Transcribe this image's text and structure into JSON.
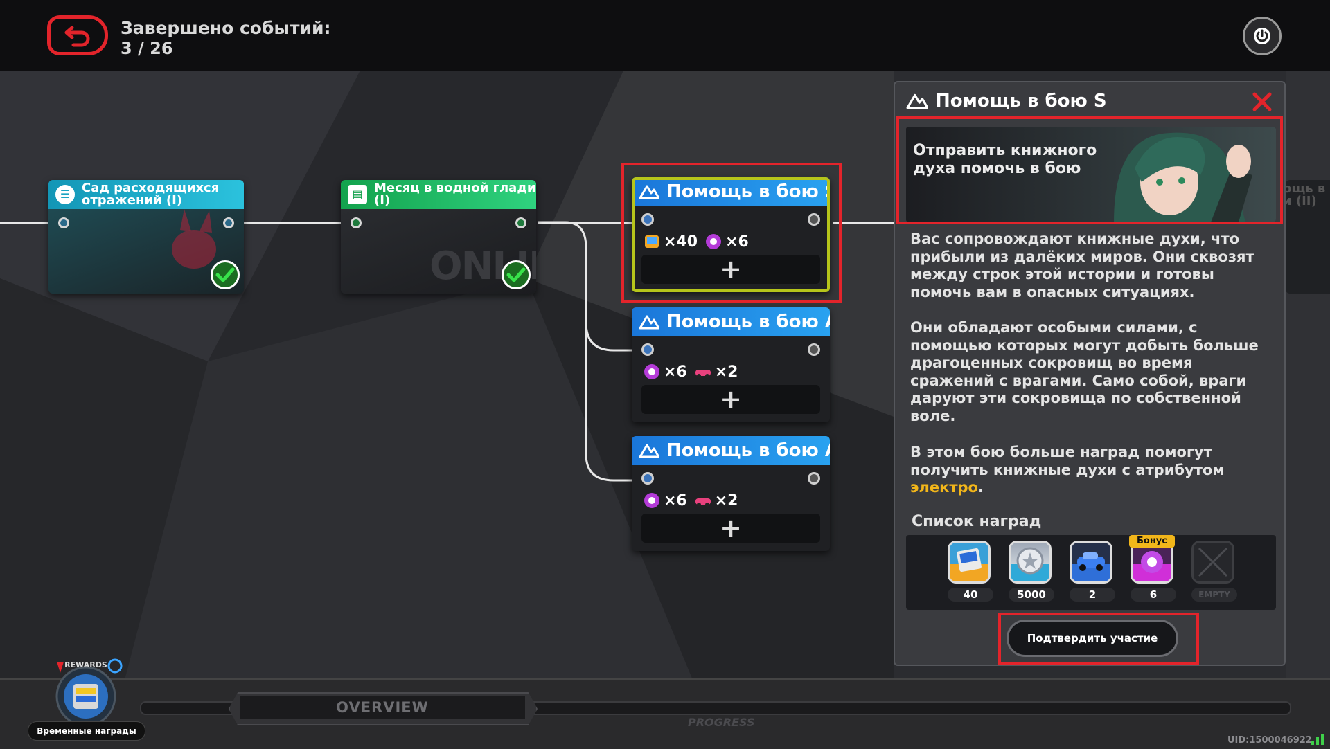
{
  "header": {
    "events_completed_label": "Завершено событий:",
    "events_completed_count": "3 / 26"
  },
  "nodes": [
    {
      "title": "Сад расходящихся отражений (I)",
      "completed": true,
      "color": "#1aa3c2"
    },
    {
      "title": "Месяц в водной глади (I)",
      "completed": true,
      "color": "#1fb867",
      "art_text": "ONLINE"
    }
  ],
  "battle_nodes": [
    {
      "title": "Помощь в бою S",
      "rewards": [
        {
          "icon": "book-card-icon",
          "qty": "×40"
        },
        {
          "icon": "purple-gear-icon",
          "qty": "×6"
        }
      ],
      "add_label": "+"
    },
    {
      "title": "Помощь в бою A",
      "rewards": [
        {
          "icon": "purple-gear-icon",
          "qty": "×6"
        },
        {
          "icon": "car-icon",
          "qty": "×2"
        }
      ],
      "add_label": "+"
    },
    {
      "title": "Помощь в бою A",
      "rewards": [
        {
          "icon": "purple-gear-icon",
          "qty": "×6"
        },
        {
          "icon": "car-icon",
          "qty": "×2"
        }
      ],
      "add_label": "+"
    }
  ],
  "panel": {
    "title": "Помощь в бою S",
    "banner_text": "Отправить книжного духа помочь в бою",
    "desc_1": "Вас сопровождают книжные духи, что прибыли из далёких миров. Они сквозят между строк этой истории и готовы помочь вам в опасных ситуациях.",
    "desc_2": "Они обладают особыми силами, с помощью которых могут добыть больше драгоценных сокровищ во время сражений с врагами. Само собой, враги даруют эти сокровища по собственной воле.",
    "desc_3_pre": "В этом бою больше наград помогут получить книжные духи с атрибутом ",
    "desc_3_highlight": "электро",
    "desc_3_post": ".",
    "rewards_title": "Список наград",
    "rewards": [
      {
        "icon": "book-card-icon",
        "count": "40",
        "color": "#f2a623"
      },
      {
        "icon": "silver-coin-icon",
        "count": "5000",
        "color": "#2fa9d8"
      },
      {
        "icon": "blue-car-icon",
        "count": "2",
        "color": "#2f6fd8"
      },
      {
        "icon": "purple-gear-icon",
        "count": "6",
        "color": "#d02fd8",
        "bonus": "Бонус"
      },
      {
        "icon": "empty-slot-icon",
        "count": "EMPTY",
        "color": "#2b2c30"
      }
    ],
    "confirm_label": "Подтвердить участие"
  },
  "next_node_partial": "ощь в бою\nи (II)",
  "bottom": {
    "overview_label": "OVERVIEW",
    "progress_label": "PROGRESS",
    "timed_rewards_label": "Временные награды",
    "rewards_badge": "REWARDS",
    "uid": "UID:1500046922"
  },
  "colors": {
    "accent_red": "#e3242b",
    "battle_blue": "#1a76d9",
    "selection_yellow": "#b6c51b",
    "electro_highlight": "#f2b61a"
  }
}
